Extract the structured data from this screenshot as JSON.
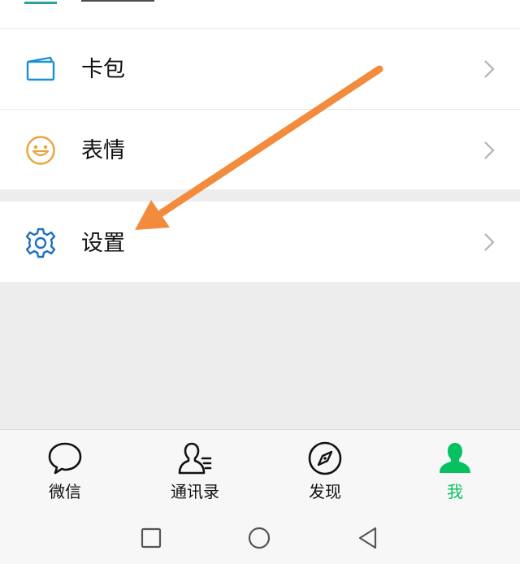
{
  "colors": {
    "background": "#ededed",
    "accent_green": "#07c160",
    "arrow_orange": "#f28c3c",
    "card_icon_blue": "#1a8fd6",
    "emoji_icon_yellow": "#e8a33a",
    "settings_icon_blue": "#1e6fc2"
  },
  "menu": {
    "partial_item_icon": "partial-item-icon",
    "items": [
      {
        "label": "卡包",
        "icon": "card-wallet-icon"
      },
      {
        "label": "表情",
        "icon": "emoji-icon"
      },
      {
        "label": "设置",
        "icon": "gear-icon"
      }
    ]
  },
  "annotation": {
    "icon": "arrow-pointer"
  },
  "tabbar": {
    "tabs": [
      {
        "label": "微信",
        "icon": "chat-bubble-icon",
        "active": false
      },
      {
        "label": "通讯录",
        "icon": "contacts-icon",
        "active": false
      },
      {
        "label": "发现",
        "icon": "compass-icon",
        "active": false
      },
      {
        "label": "我",
        "icon": "person-icon",
        "active": true
      }
    ]
  },
  "system_nav": {
    "buttons": [
      {
        "icon": "recents-square-icon"
      },
      {
        "icon": "home-circle-icon"
      },
      {
        "icon": "back-triangle-icon"
      }
    ]
  }
}
